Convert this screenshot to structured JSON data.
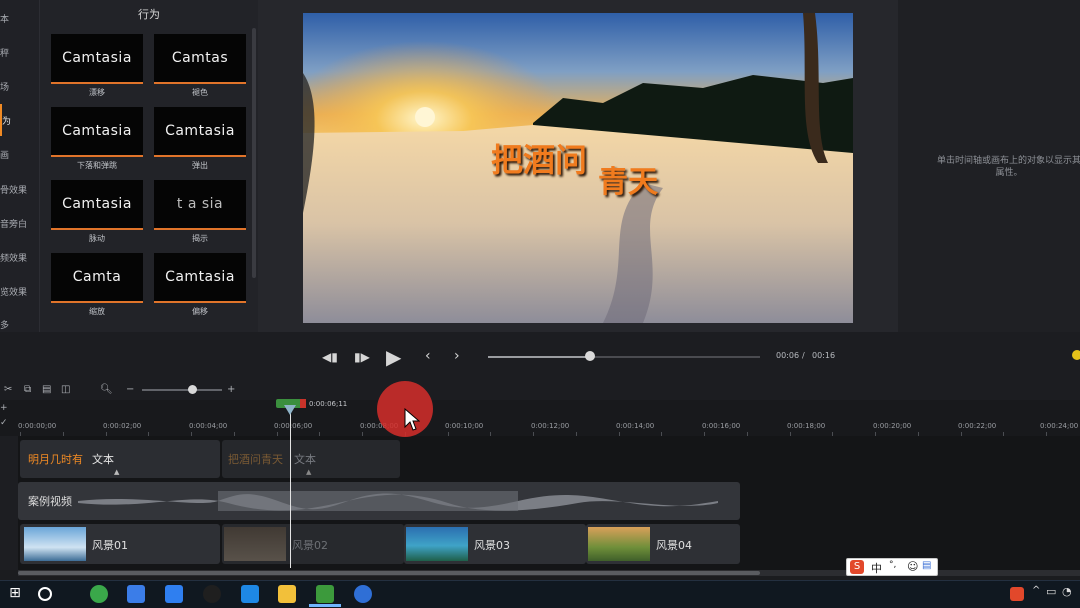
{
  "left_nav": {
    "items": [
      {
        "label": "本"
      },
      {
        "label": "秤"
      },
      {
        "label": "场"
      },
      {
        "label": "为"
      },
      {
        "label": "画"
      },
      {
        "label": "骨效果"
      },
      {
        "label": "音旁白"
      },
      {
        "label": "频效果"
      },
      {
        "label": "览效果"
      },
      {
        "label": "多"
      }
    ],
    "active_index": 3
  },
  "behaviors_panel": {
    "title": "行为",
    "thumbnails": [
      {
        "preview_text": "Camtasia",
        "label": "漂移"
      },
      {
        "preview_text": "Camtas",
        "label": "褪色"
      },
      {
        "preview_text": "Camtasia",
        "label": "下落和弹跳"
      },
      {
        "preview_text": "Camtasia",
        "label": "弹出"
      },
      {
        "preview_text": "Camtasia",
        "label": "脉动"
      },
      {
        "preview_text": "t  a  sia",
        "label": "揭示"
      },
      {
        "preview_text": "Camta",
        "label": "缩放"
      },
      {
        "preview_text": "Camtasia",
        "label": "偏移"
      }
    ]
  },
  "preview": {
    "overlay_line1": "把酒问",
    "overlay_line2": "青天"
  },
  "properties": {
    "hint": "单击时间轴或画布上的对象以显示其属性。"
  },
  "transport": {
    "current_time": "00:06",
    "separator": "/",
    "total_time": "00:16",
    "progress": 0.375
  },
  "timeline": {
    "zoom_level": 0.6,
    "playhead_time": "0:00:06;11",
    "ruler_labels": [
      "0:00:00;00",
      "0:00:02;00",
      "0:00:04;00",
      "0:00:06;00",
      "0:00:08;00",
      "0:00:10;00",
      "0:00:12;00",
      "0:00:14;00",
      "0:00:16;00",
      "0:00:18;00",
      "0:00:20;00",
      "0:00:22;00",
      "0:00:24;00"
    ],
    "text_clips": [
      {
        "title": "明月几时有",
        "type": "文本"
      },
      {
        "title": "把酒问青天",
        "type": "文本"
      }
    ],
    "audio_clip": {
      "name": "案例视频"
    },
    "video_clips": [
      {
        "name": "风景01"
      },
      {
        "name": "风景02"
      },
      {
        "name": "风景03"
      },
      {
        "name": "风景04"
      }
    ]
  },
  "ime": {
    "logo": "S",
    "mode": "中",
    "punct": "°,"
  },
  "taskbar": {
    "apps": [
      "start",
      "search",
      "browser-360",
      "cloud-drive",
      "feishu",
      "qq",
      "phone-manager",
      "file-explorer",
      "camtasia",
      "settings-app"
    ]
  },
  "colors": {
    "accent_orange": "#f08a24",
    "title_orange": "#f07b1e",
    "playhead_green": "#3b8f3e",
    "cursor_red": "#d62e2a"
  }
}
